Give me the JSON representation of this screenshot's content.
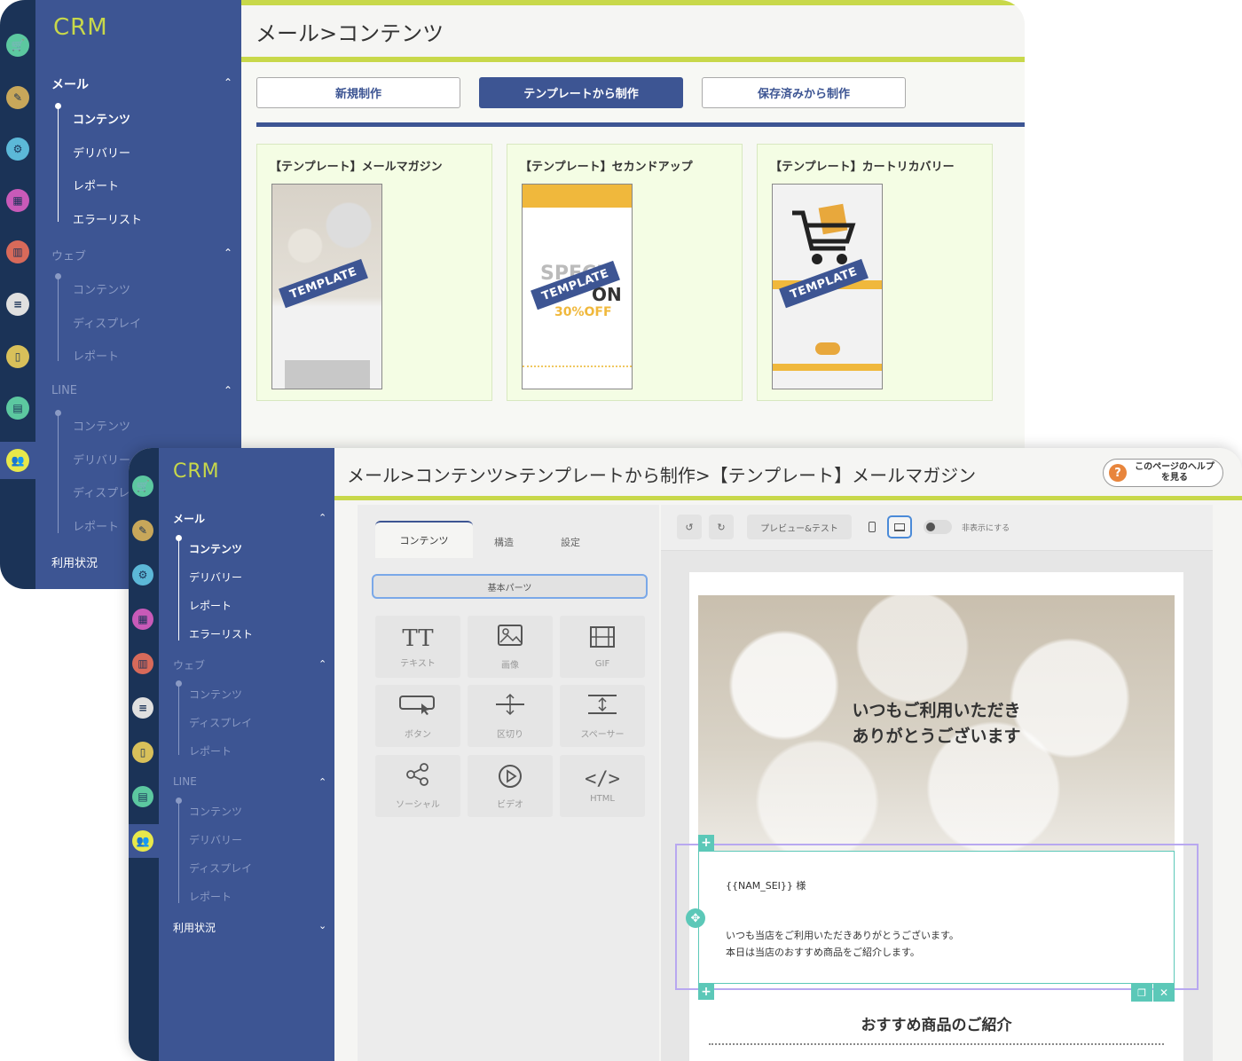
{
  "back_window": {
    "app_title": "CRM",
    "breadcrumb": "メール>コンテンツ",
    "sidebar": {
      "mail_section": "メール",
      "mail_items": [
        "コンテンツ",
        "デリバリー",
        "レポート",
        "エラーリスト"
      ],
      "web_section": "ウェブ",
      "web_items": [
        "コンテンツ",
        "ディスプレイ",
        "レポート"
      ],
      "line_section": "LINE",
      "line_items": [
        "コンテンツ",
        "デリバリー",
        "ディスプレイ",
        "レポート"
      ],
      "usage_label": "利用状況"
    },
    "buttons": {
      "new": "新規制作",
      "from_template": "テンプレートから制作",
      "from_saved": "保存済みから制作"
    },
    "templates": [
      {
        "title": "【テンプレート】メールマガジン",
        "badge": "TEMPLATE"
      },
      {
        "title": "【テンプレート】セカンドアップ",
        "badge": "TEMPLATE",
        "sale_big": "SPECI",
        "sale_on": "ON",
        "sale_off": "30%OFF"
      },
      {
        "title": "【テンプレート】カートリカバリー",
        "badge": "TEMPLATE"
      }
    ]
  },
  "front_window": {
    "app_title": "CRM",
    "breadcrumb": "メール>コンテンツ>テンプレートから制作>【テンプレート】メールマガジン",
    "help_text": "このページのヘルプを見る",
    "sidebar": {
      "mail_section": "メール",
      "mail_items": [
        "コンテンツ",
        "デリバリー",
        "レポート",
        "エラーリスト"
      ],
      "web_section": "ウェブ",
      "web_items": [
        "コンテンツ",
        "ディスプレイ",
        "レポート"
      ],
      "line_section": "LINE",
      "line_items": [
        "コンテンツ",
        "デリバリー",
        "ディスプレイ",
        "レポート"
      ],
      "usage_label": "利用状況"
    },
    "tabs": [
      "コンテンツ",
      "構造",
      "設定"
    ],
    "section_button": "基本パーツ",
    "parts": [
      {
        "icon": "text-icon",
        "label": "テキスト"
      },
      {
        "icon": "image-icon",
        "label": "画像"
      },
      {
        "icon": "gif-icon",
        "label": "GIF"
      },
      {
        "icon": "button-icon",
        "label": "ボタン"
      },
      {
        "icon": "divider-icon",
        "label": "区切り"
      },
      {
        "icon": "spacer-icon",
        "label": "スペーサー"
      },
      {
        "icon": "social-icon",
        "label": "ソーシャル"
      },
      {
        "icon": "video-icon",
        "label": "ビデオ"
      },
      {
        "icon": "html-icon",
        "label": "HTML"
      }
    ],
    "toolbar": {
      "preview_label": "プレビュー&テスト",
      "toggle_label": "非表示にする"
    },
    "email": {
      "hero_line1": "いつもご利用いただき",
      "hero_line2": "ありがとうございます",
      "salutation": "{{NAM_SEI}} 様",
      "body_line1": "いつも当店をご利用いただきありがとうございます。",
      "body_line2": "本日は当店のおすすめ商品をご紹介します。",
      "section_heading": "おすすめ商品のご紹介"
    }
  },
  "colors": {
    "rail": "#1b3357",
    "sidebar": "#3d5593",
    "accent_lime": "#c8d84a",
    "primary_button": "#3d5593",
    "card_bg": "#f4fde4",
    "selection_teal": "#5cc8b8"
  }
}
